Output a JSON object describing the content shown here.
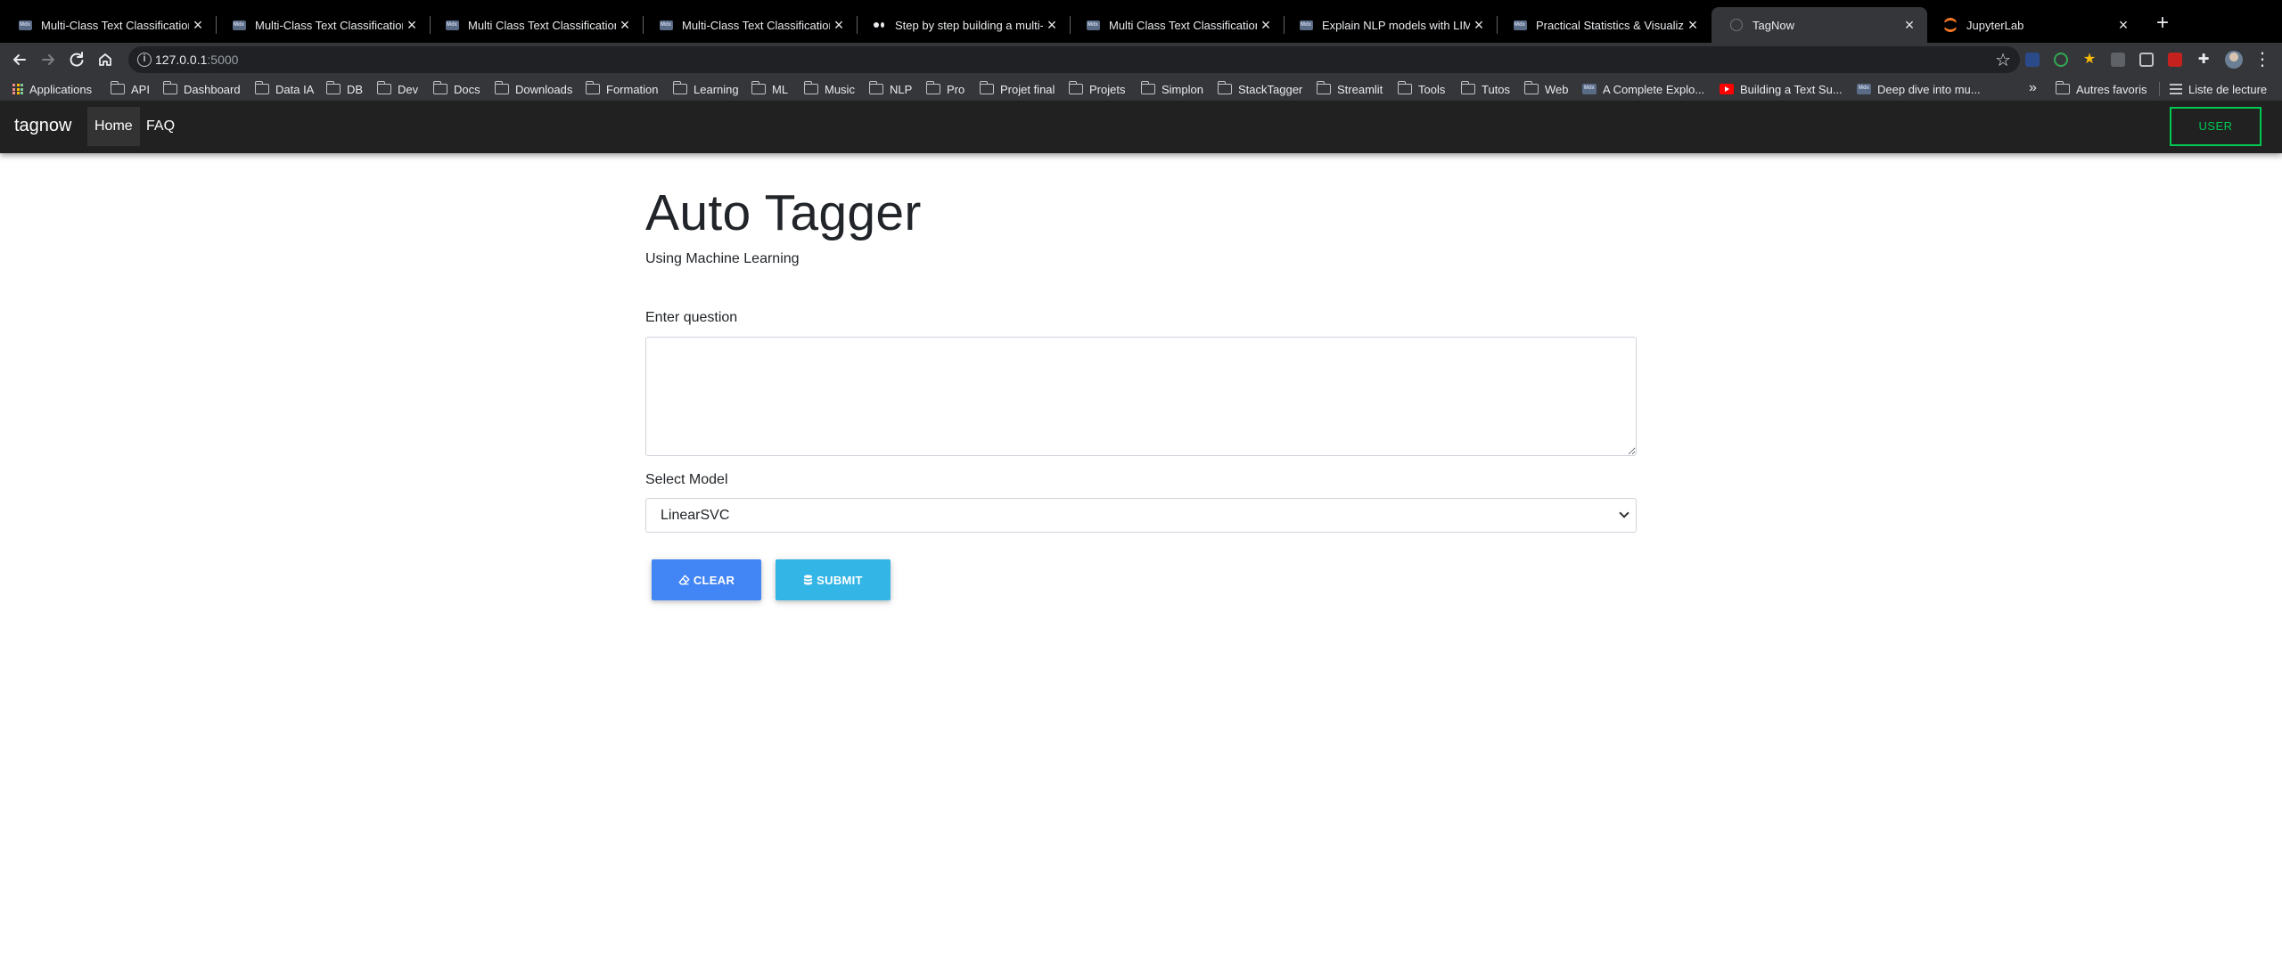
{
  "browser": {
    "tabs": [
      {
        "title": "Multi-Class Text Classification",
        "icon": "medium-article-icon",
        "active": false
      },
      {
        "title": "Multi-Class Text Classification",
        "icon": "medium-article-icon",
        "active": false
      },
      {
        "title": "Multi Class Text Classification",
        "icon": "medium-article-icon",
        "active": false
      },
      {
        "title": "Multi-Class Text Classification",
        "icon": "medium-article-icon",
        "active": false
      },
      {
        "title": "Step by step building a multi-c",
        "icon": "medium-logo-icon",
        "active": false
      },
      {
        "title": "Multi Class Text Classification",
        "icon": "medium-article-icon",
        "active": false
      },
      {
        "title": "Explain NLP models with LIME",
        "icon": "medium-article-icon",
        "active": false
      },
      {
        "title": "Practical Statistics & Visualiza",
        "icon": "medium-article-icon",
        "active": false
      },
      {
        "title": "TagNow",
        "icon": "globe-icon",
        "active": true
      },
      {
        "title": "JupyterLab",
        "icon": "jupyter-icon",
        "active": false
      }
    ],
    "favicon_text": "Mdx",
    "close_glyph": "×",
    "new_tab_glyph": "+",
    "url_host": "127.0.0.1",
    "url_port": ":5000",
    "bookmarks": [
      "Applications",
      "API",
      "Dashboard",
      "Data IA",
      "DB",
      "Dev",
      "Docs",
      "Downloads",
      "Formation",
      "Learning",
      "ML",
      "Music",
      "NLP",
      "Pro",
      "Projet final",
      "Projets",
      "Simplon",
      "StackTagger",
      "Streamlit",
      "Tools",
      "Tutos",
      "Web",
      "A Complete Explo...",
      "Building a Text Su...",
      "Deep dive into mu..."
    ],
    "bookmarks_more": "»",
    "other_bookmarks": "Autres favoris",
    "reading_list": "Liste de lecture"
  },
  "navbar": {
    "brand": "tagnow",
    "links": [
      "Home",
      "FAQ"
    ],
    "active_link": "Home",
    "user_button": "USER",
    "colors": {
      "bg": "#212121",
      "user_accent": "#00c851"
    }
  },
  "main": {
    "title": "Auto Tagger",
    "subtitle": "Using Machine Learning",
    "question_label": "Enter question",
    "question_value": "",
    "model_label": "Select Model",
    "model_selected": "LinearSVC",
    "clear_button": "CLEAR",
    "submit_button": "SUBMIT",
    "colors": {
      "clear": "#4285f4",
      "submit": "#33b5e5"
    }
  }
}
